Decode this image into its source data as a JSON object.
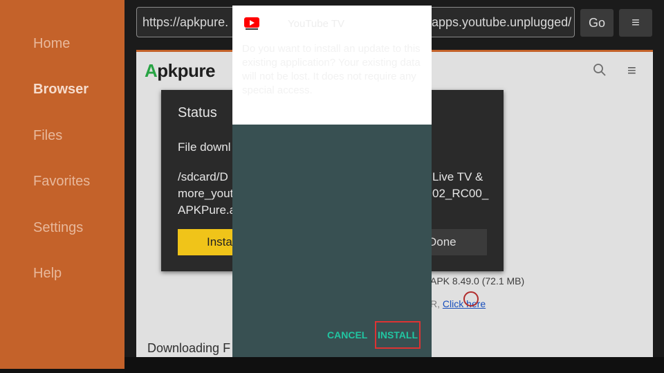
{
  "sidebar": {
    "items": [
      {
        "label": "Home"
      },
      {
        "label": "Browser"
      },
      {
        "label": "Files"
      },
      {
        "label": "Favorites"
      },
      {
        "label": "Settings"
      },
      {
        "label": "Help"
      }
    ],
    "active": "Browser"
  },
  "toolbar": {
    "url_start": "https://apkpure.",
    "url_end": "apps.youtube.unplugged/",
    "go_label": "Go",
    "menu_icon": "≡"
  },
  "webpage": {
    "logo_a": "A",
    "logo_rest": "pkpure",
    "apk_info": "APK 8.49.0 (72.1 MB)",
    "link_prefix": "R,",
    "link_text": "Click here",
    "downloading_label": "Downloading F"
  },
  "status_dialog": {
    "title": "Status",
    "message": "File downl",
    "path_left": "/sdcard/D\nmore_yout\nAPKPure.a",
    "path_right": "Live TV &\n02_RC00_",
    "install_label": "Insta",
    "done_label": "Done"
  },
  "installer": {
    "app_name": "YouTube TV",
    "description": "Do you want to install an update to this existing application? Your existing data will not be lost. It does not require any special access.",
    "cancel_label": "CANCEL",
    "install_label": "INSTALL"
  },
  "colors": {
    "sidebar": "#c4622a",
    "accent_teal": "#21c6a2",
    "install_highlight": "#dd3333",
    "dialog_bg": "#385052"
  }
}
